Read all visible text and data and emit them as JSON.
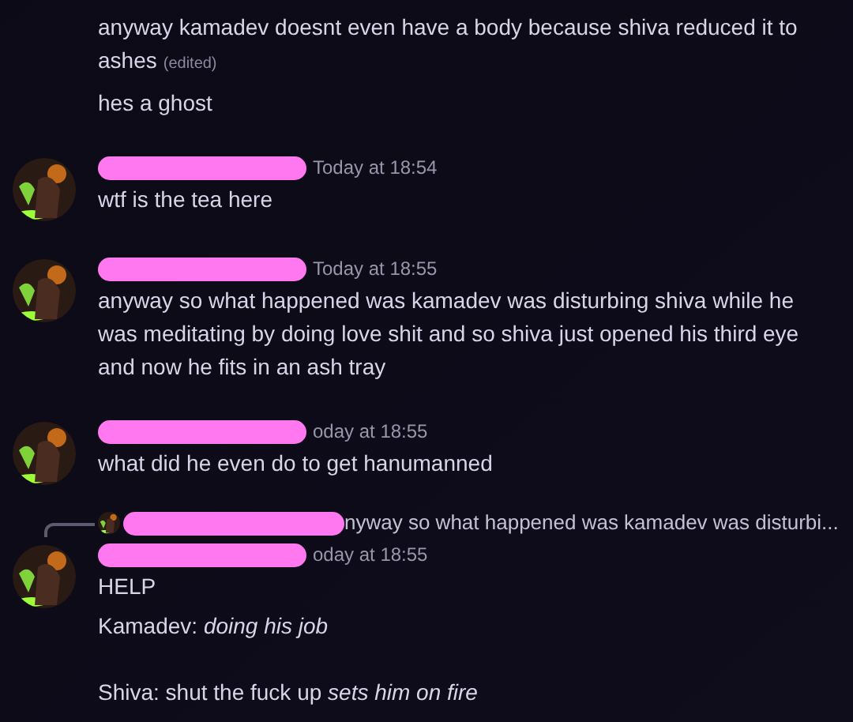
{
  "messages": [
    {
      "lines": [
        {
          "text": "anyway kamadev doesnt even have a body because shiva reduced it to ashes",
          "edited": "(edited)"
        },
        {
          "text": "hes a ghost"
        }
      ]
    },
    {
      "timestamp": "Today at 18:54",
      "lines": [
        {
          "text": "wtf is the tea here"
        }
      ]
    },
    {
      "timestamp": "Today at 18:55",
      "lines": [
        {
          "text": "anyway so what happened was kamadev was disturbing shiva while he was meditating by doing love shit and so shiva just opened his third eye and now he fits in an ash tray"
        }
      ]
    },
    {
      "timestamp": "oday at 18:55",
      "lines": [
        {
          "text": "what did he even do to get hanumanned"
        }
      ]
    },
    {
      "reply": {
        "text": "nyway so what happened was kamadev was disturbi..."
      },
      "timestamp": "oday at 18:55",
      "lines": [
        {
          "text": "HELP"
        },
        {
          "text": "Kamadev: *doing his job*\n\nShiva: shut the fuck up *sets him on fire*"
        }
      ]
    }
  ]
}
